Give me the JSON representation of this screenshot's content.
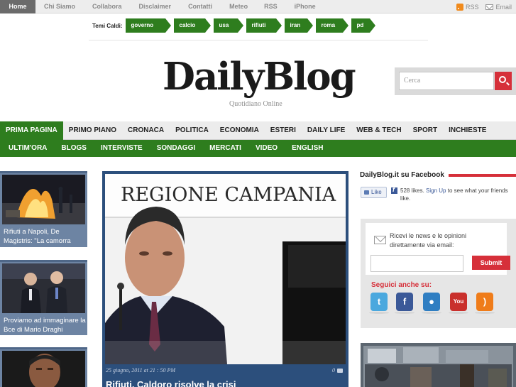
{
  "topbar": {
    "nav": [
      "Home",
      "Chi Siamo",
      "Collabora",
      "Disclaimer",
      "Contatti",
      "Meteo",
      "RSS",
      "iPhone"
    ],
    "rss_label": "RSS",
    "email_label": "Email"
  },
  "hot": {
    "label": "Temi Caldi:",
    "tags": [
      "governo",
      "calcio",
      "usa",
      "rifiuti",
      "iran",
      "roma",
      "pd"
    ]
  },
  "brand": {
    "logo": "DailyBlog",
    "tagline": "Quotidiano Online"
  },
  "search": {
    "placeholder": "Cerca"
  },
  "mainnav": [
    "PRIMA PAGINA",
    "PRIMO PIANO",
    "CRONACA",
    "POLITICA",
    "ECONOMIA",
    "ESTERI",
    "DAILY LIFE",
    "WEB & TECH",
    "SPORT",
    "INCHIESTE"
  ],
  "subnav": [
    "ULTIM'ORA",
    "BLOGS",
    "INTERVISTE",
    "SONDAGGI",
    "MERCATI",
    "VIDEO",
    "ENGLISH"
  ],
  "left_cards": [
    {
      "caption": "Rifiuti a Napoli, De Magistris: \"La camorra"
    },
    {
      "caption": "Proviamo ad immaginare la Bce di Mario Draghi"
    },
    {
      "caption": ""
    }
  ],
  "feature": {
    "sign_text": "REGIONE CAMPANIA",
    "meta": "25 giugno, 2011 at 21 : 50 PM",
    "comments": "0",
    "headline": "Rifiuti, Caldoro risolve la crisi"
  },
  "facebook": {
    "heading": "DailyBlog.it su Facebook",
    "like_label": "Like",
    "text_pre": "528 likes.",
    "text_link": "Sign Up",
    "text_post": "to see what your friends like."
  },
  "newsletter": {
    "text": "Ricevi le news e le opinioni direttamente via email:",
    "submit_label": "Submit",
    "follow_label": "Seguici anche su:",
    "social_icons": [
      "twitter-icon",
      "facebook-icon",
      "apple-icon",
      "youtube-icon",
      "rss-icon"
    ]
  },
  "colors": {
    "green": "#2e7d1e",
    "red": "#d6303a",
    "blue": "#2c4f7c",
    "card_blue": "#6d84a3"
  }
}
